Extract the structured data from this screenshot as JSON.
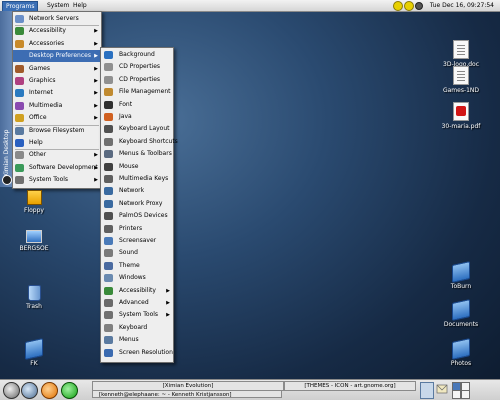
{
  "top_panel": {
    "menus": [
      "Programs",
      "System",
      "Help"
    ],
    "clock": "Tue Dec 16, 09:27:54"
  },
  "side_strip": {
    "label": "Ximian Desktop"
  },
  "programs_menu": {
    "items": [
      {
        "label": "Network Servers",
        "icon": "network-servers-icon",
        "submenu": false
      },
      {
        "label": "Accessibility",
        "icon": "accessibility-icon",
        "submenu": true
      },
      {
        "label": "Accessories",
        "icon": "accessories-icon",
        "submenu": true
      },
      {
        "label": "Desktop Preferences",
        "icon": "desktop-preferences-icon",
        "submenu": true,
        "active": true
      },
      {
        "label": "Games",
        "icon": "games-icon",
        "submenu": true
      },
      {
        "label": "Graphics",
        "icon": "graphics-icon",
        "submenu": true
      },
      {
        "label": "Internet",
        "icon": "internet-icon",
        "submenu": true
      },
      {
        "label": "Multimedia",
        "icon": "multimedia-icon",
        "submenu": true
      },
      {
        "label": "Office",
        "icon": "office-icon",
        "submenu": true
      },
      {
        "label": "Browse Filesystem",
        "icon": "browse-filesystem-icon",
        "submenu": false
      },
      {
        "label": "Help",
        "icon": "help-icon",
        "submenu": false
      },
      {
        "label": "Other",
        "icon": "other-icon",
        "submenu": true
      },
      {
        "label": "Software Development",
        "icon": "software-development-icon",
        "submenu": true
      },
      {
        "label": "System Tools",
        "icon": "system-tools-icon",
        "submenu": true
      }
    ]
  },
  "prefs_submenu": {
    "items": [
      {
        "label": "Background",
        "submenu": false
      },
      {
        "label": "CD Properties",
        "submenu": false
      },
      {
        "label": "CD Properties",
        "submenu": false
      },
      {
        "label": "File Management",
        "submenu": false
      },
      {
        "label": "Font",
        "submenu": false
      },
      {
        "label": "Java",
        "submenu": false
      },
      {
        "label": "Keyboard Layout",
        "submenu": false
      },
      {
        "label": "Keyboard Shortcuts",
        "submenu": false
      },
      {
        "label": "Menus & Toolbars",
        "submenu": false
      },
      {
        "label": "Mouse",
        "submenu": false
      },
      {
        "label": "Multimedia Keys",
        "submenu": false
      },
      {
        "label": "Network",
        "submenu": false
      },
      {
        "label": "Network Proxy",
        "submenu": false
      },
      {
        "label": "PalmOS Devices",
        "submenu": false
      },
      {
        "label": "Printers",
        "submenu": false
      },
      {
        "label": "Screensaver",
        "submenu": false
      },
      {
        "label": "Sound",
        "submenu": false
      },
      {
        "label": "Theme",
        "submenu": false
      },
      {
        "label": "Windows",
        "submenu": false
      },
      {
        "label": "Accessibility",
        "submenu": true
      },
      {
        "label": "Advanced",
        "submenu": true
      },
      {
        "label": "System Tools",
        "submenu": true
      },
      {
        "label": "Keyboard",
        "submenu": false
      },
      {
        "label": "Menus",
        "submenu": false
      },
      {
        "label": "Screen Resolution",
        "submenu": false
      }
    ]
  },
  "desktop_icons": {
    "floppy": "Floppy",
    "bergsoe": "BERGSOE",
    "trash": "Trash",
    "fk": "FK",
    "doc1": "3D-logo.doc",
    "doc2": "Games-1ND",
    "pdf": "30-maria.pdf",
    "toburn": "ToBurn",
    "documents": "Documents",
    "photos": "Photos"
  },
  "bottom_panel": {
    "tasks": [
      "[Ximian Evolution]",
      "[kenneth@elephaane: ~ - Kenneth Kristjansson]",
      "[THEMES - ICON - art.gnome.org]"
    ]
  },
  "colors": {
    "menu_highlight": "#3d6db3",
    "desktop_bg": "#2a4a70"
  }
}
